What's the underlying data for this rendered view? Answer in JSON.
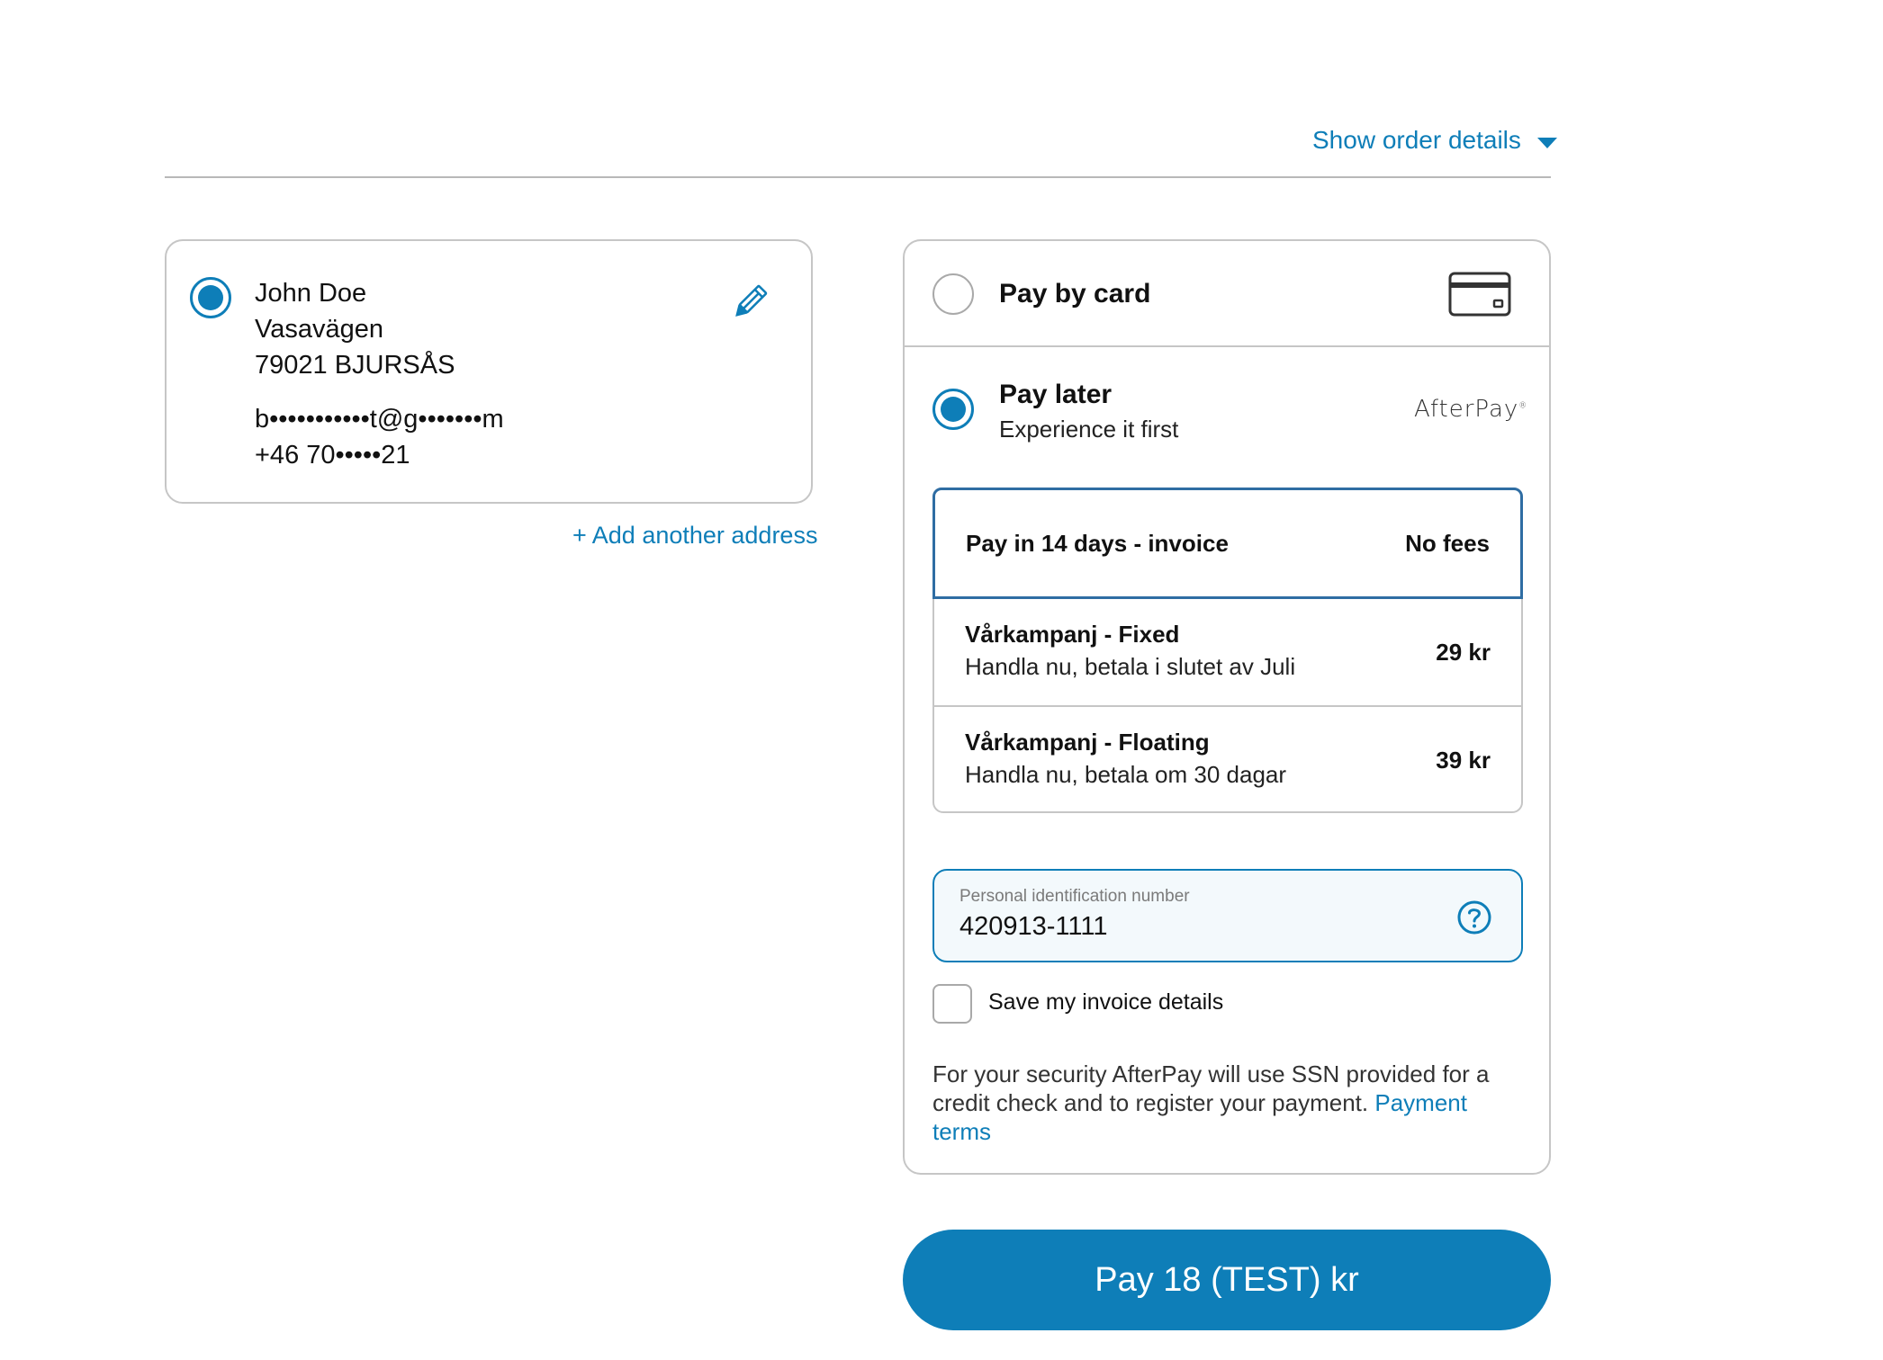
{
  "header": {
    "order_toggle_label": "Show order details",
    "order_toggle_icon": "caret-down-icon"
  },
  "address": {
    "selected": true,
    "name": "John Doe",
    "street": "Vasavägen",
    "city_line": "79021 BJURSÅS",
    "email": "b•••••••••••t@g•••••••m",
    "phone": "+46 70•••••21",
    "edit_icon": "pencil-icon",
    "add_another_label": "+ Add another address"
  },
  "payment": {
    "card_option": {
      "label": "Pay by card",
      "selected": false,
      "icon": "credit-card-icon"
    },
    "later_option": {
      "label": "Pay later",
      "subtitle": "Experience it first",
      "selected": true,
      "brand_logo": "AfterPay"
    },
    "plans": [
      {
        "name": "Pay in 14 days - invoice",
        "description": "",
        "price": "No fees",
        "selected": true
      },
      {
        "name": "Vårkampanj - Fixed",
        "description": "Handla nu, betala i slutet av Juli",
        "price": "29 kr",
        "selected": false
      },
      {
        "name": "Vårkampanj - Floating",
        "description": "Handla nu, betala om 30 dagar",
        "price": "39 kr",
        "selected": false
      }
    ],
    "pin_field": {
      "label": "Personal identification number",
      "value": "420913-1111",
      "help_icon": "question-circle-icon"
    },
    "save_details": {
      "label": "Save my invoice details",
      "checked": false
    },
    "security_text": "For your security AfterPay will use SSN provided for a credit check and to register your payment.",
    "terms_link": "Payment terms"
  },
  "pay_button_label": "Pay 18 (TEST) kr",
  "colors": {
    "accent": "#0e7eb8",
    "selected_plan_border": "#2f6da3",
    "border": "#c6c6c6"
  }
}
